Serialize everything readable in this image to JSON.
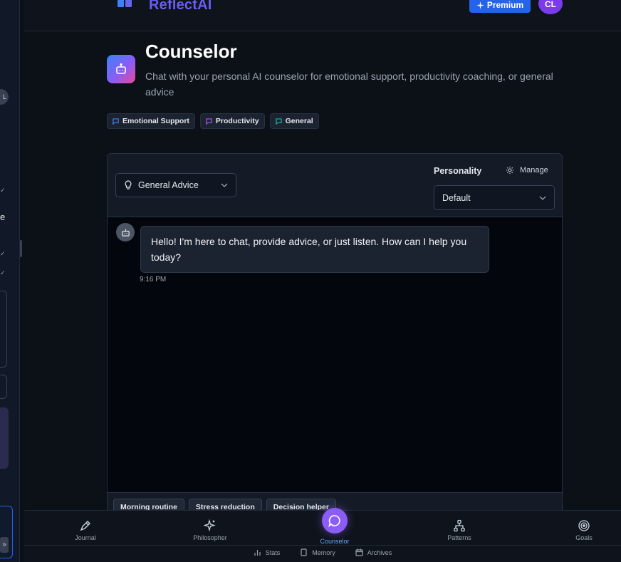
{
  "header": {
    "brand": "ReflectAI",
    "premium_label": "Premium",
    "avatar_initials": "CL"
  },
  "left_sidebar": {
    "avatar_initials": "L",
    "fragment_letter": "e",
    "collapse_symbol": "»"
  },
  "page": {
    "title": "Counselor",
    "description": "Chat with your personal AI counselor for emotional support, productivity coaching, or general advice",
    "chips": [
      {
        "label": "Emotional Support",
        "color": "#3b82f6"
      },
      {
        "label": "Productivity",
        "color": "#a855f7"
      },
      {
        "label": "General",
        "color": "#14b8a6"
      }
    ]
  },
  "chat": {
    "mode_select": {
      "value": "General Advice",
      "icon": "lightbulb-icon"
    },
    "personality_label": "Personality",
    "manage_label": "Manage",
    "personality_select": {
      "value": "Default"
    },
    "messages": [
      {
        "sender": "assistant",
        "text": "Hello! I'm here to chat, provide advice, or just listen. How can I help you today?",
        "time": "9:16 PM"
      }
    ],
    "quick_replies": [
      "Morning routine",
      "Stress reduction",
      "Decision helper"
    ]
  },
  "bottom_nav": {
    "items": [
      {
        "label": "Journal",
        "icon": "pen-icon"
      },
      {
        "label": "Philosopher",
        "icon": "sparkles-icon"
      },
      {
        "label": "Counselor",
        "icon": "chat-bubble-icon",
        "active": true
      },
      {
        "label": "Patterns",
        "icon": "network-icon"
      },
      {
        "label": "Goals",
        "icon": "target-icon"
      }
    ],
    "sub_items": [
      {
        "label": "Stats",
        "icon": "bar-chart-icon"
      },
      {
        "label": "Memory",
        "icon": "book-icon"
      },
      {
        "label": "Archives",
        "icon": "calendar-icon"
      }
    ]
  },
  "colors": {
    "accent": "#2563eb",
    "brand": "#6b5cf6",
    "active_nav": "#60a5fa"
  }
}
